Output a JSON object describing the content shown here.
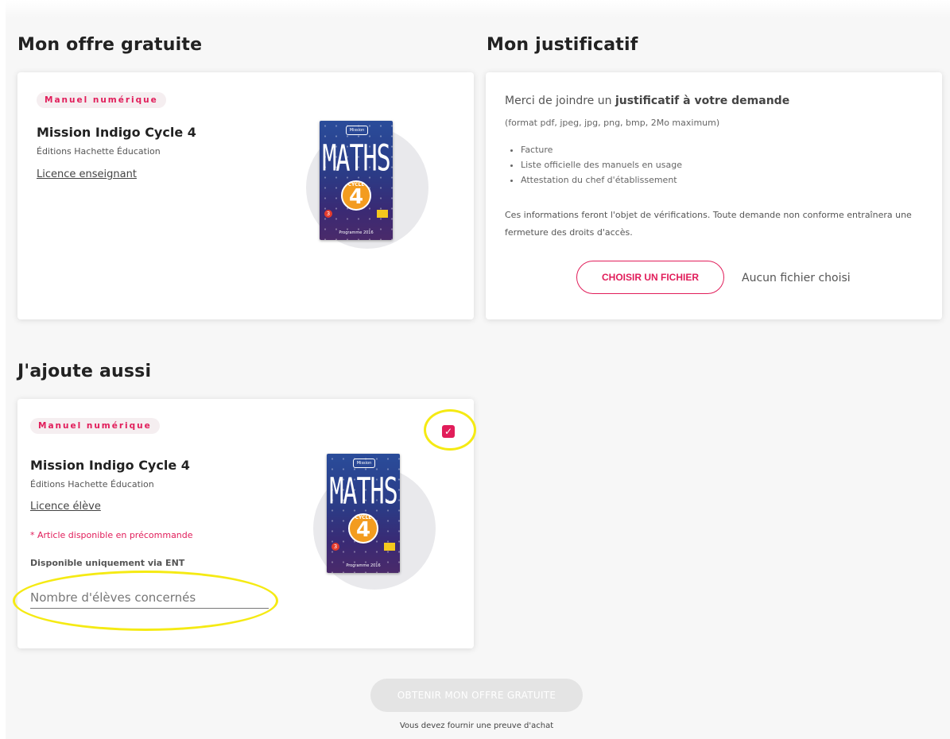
{
  "offer": {
    "heading": "Mon offre gratuite",
    "badge": "Manuel numérique",
    "title": "Mission Indigo Cycle 4",
    "publisher": "Éditions Hachette Éducation",
    "license": "Licence enseignant"
  },
  "proof": {
    "heading": "Mon justificatif",
    "intro_prefix": "Merci de joindre un ",
    "intro_bold": "justificatif à votre demande",
    "formats": "(format pdf, jpeg, jpg, png, bmp, 2Mo maximum)",
    "items": [
      "Facture",
      "Liste officielle des manuels en usage",
      "Attestation du chef d'établissement"
    ],
    "notice": "Ces informations feront l'objet de vérifications. Toute demande non conforme entraînera une fermeture des droits d'accès.",
    "choose_file": "CHOISIR UN FICHIER",
    "no_file": "Aucun fichier choisi"
  },
  "addon": {
    "heading": "J'ajoute aussi",
    "badge": "Manuel numérique",
    "title": "Mission Indigo Cycle 4",
    "publisher": "Éditions Hachette Éducation",
    "license": "Licence élève",
    "preorder": "* Article disponible en précommande",
    "ent": "Disponible uniquement via ENT",
    "students_placeholder": "Nombre d'élèves concernés",
    "checked": true,
    "checkmark": "✓"
  },
  "cover": {
    "tag": "Mission",
    "title": "MATHS",
    "cycle": "CYCLE",
    "number": "4",
    "edition": "Programme 2016",
    "dot": "3"
  },
  "footer": {
    "submit": "OBTENIR MON OFFRE GRATUITE",
    "proof_hint": "Vous devez fournir une preuve d'achat"
  }
}
